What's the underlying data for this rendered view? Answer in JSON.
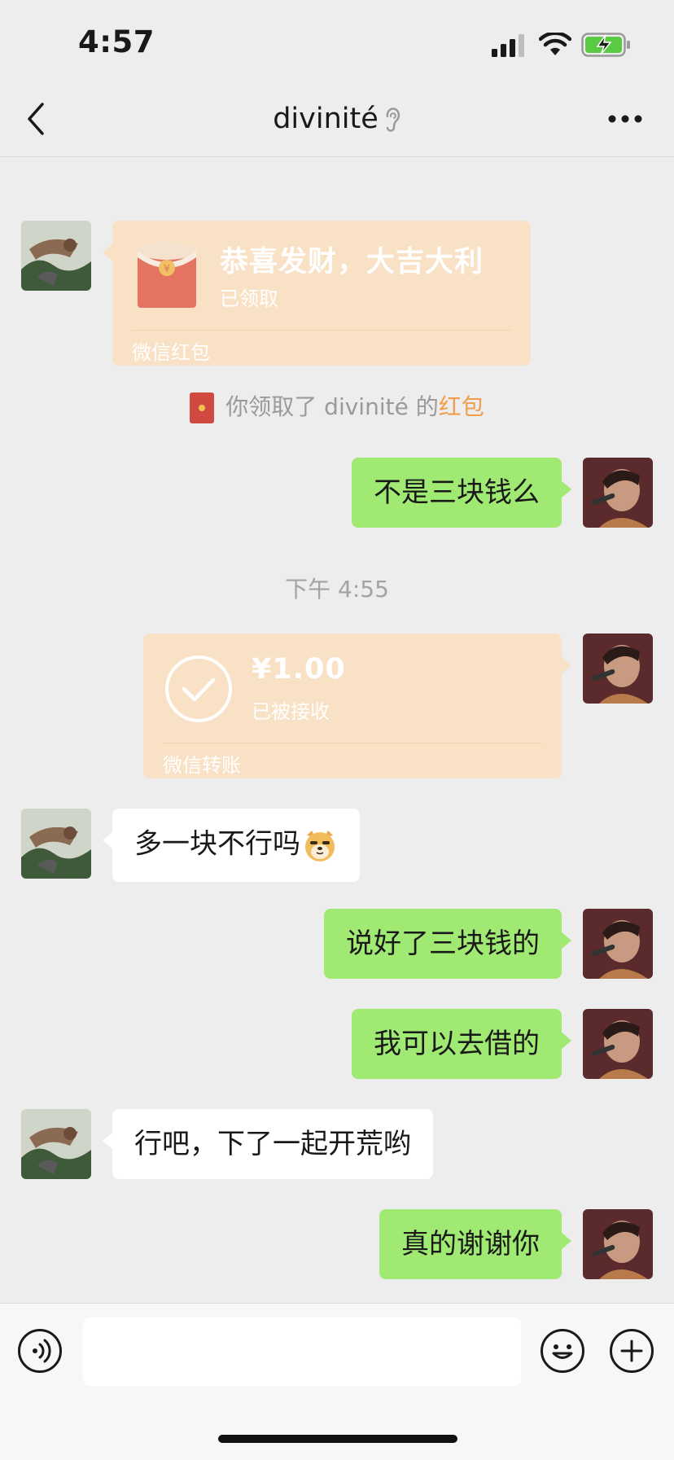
{
  "status_bar": {
    "time": "4:57",
    "battery_charging": true
  },
  "nav": {
    "title": "divinité",
    "back_icon": "chevron-left-icon",
    "more_icon": "ellipsis-icon"
  },
  "colors": {
    "background": "#ededed",
    "self_bubble": "#a0e972",
    "other_bubble": "#ffffff",
    "card": "#f9e1c6",
    "red_packet": "#d04a42",
    "link_orange": "#f19e4c"
  },
  "messages": {
    "red_packet": {
      "title": "恭喜发财，大吉大利",
      "status": "已领取",
      "footer": "微信红包"
    },
    "system_note": {
      "prefix": "你领取了 divinité 的",
      "link": "红包"
    },
    "m1": "不是三块钱么",
    "time_divider": "下午 4:55",
    "transfer": {
      "amount": "¥1.00",
      "status": "已被接收",
      "footer": "微信转账"
    },
    "m2": "多一块不行吗",
    "m3": "说好了三块钱的",
    "m4": "我可以去借的",
    "m5": "行吧，下了一起开荒哟",
    "m6": "真的谢谢你"
  },
  "input_bar": {
    "voice_icon": "voice-icon",
    "emoji_icon": "emoji-icon",
    "plus_icon": "plus-icon",
    "input_value": ""
  }
}
